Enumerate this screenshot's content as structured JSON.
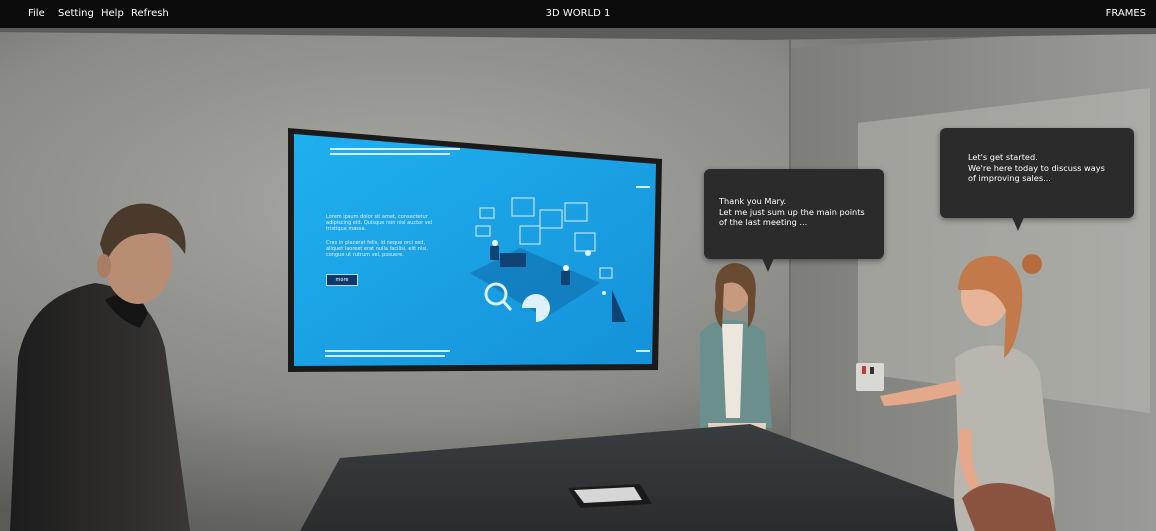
{
  "menubar": {
    "items": [
      "File",
      "Setting",
      "Help",
      "Refresh"
    ],
    "title": "3D WORLD 1",
    "frames_label": "FRAMES"
  },
  "screen": {
    "paragraph1": "Lorem ipsum dolor sit amet, consectetur adipiscing elit. Quisque non nisl auctor vel tristique massa.",
    "paragraph2": "Cras in placerat felis, id neque orci sed, aliquet laoreet erat nulla facilisi, elit nisi, congue ut rutrum vel, posuere.",
    "more_label": "more"
  },
  "bubbles": [
    {
      "speaker": "center-woman",
      "lines": [
        "Thank you Mary.",
        "Let me just sum up the main points",
        "of the last meeting ..."
      ]
    },
    {
      "speaker": "right-woman",
      "lines": [
        "Let's get started.",
        "We're here today to discuss ways",
        "of improving sales..."
      ]
    }
  ],
  "colors": {
    "menubar_bg": "#0c0c0c",
    "screen_blue": "#1aa3e8",
    "bubble_bg": "#2b2b2b",
    "wall": "#8a8a86"
  }
}
